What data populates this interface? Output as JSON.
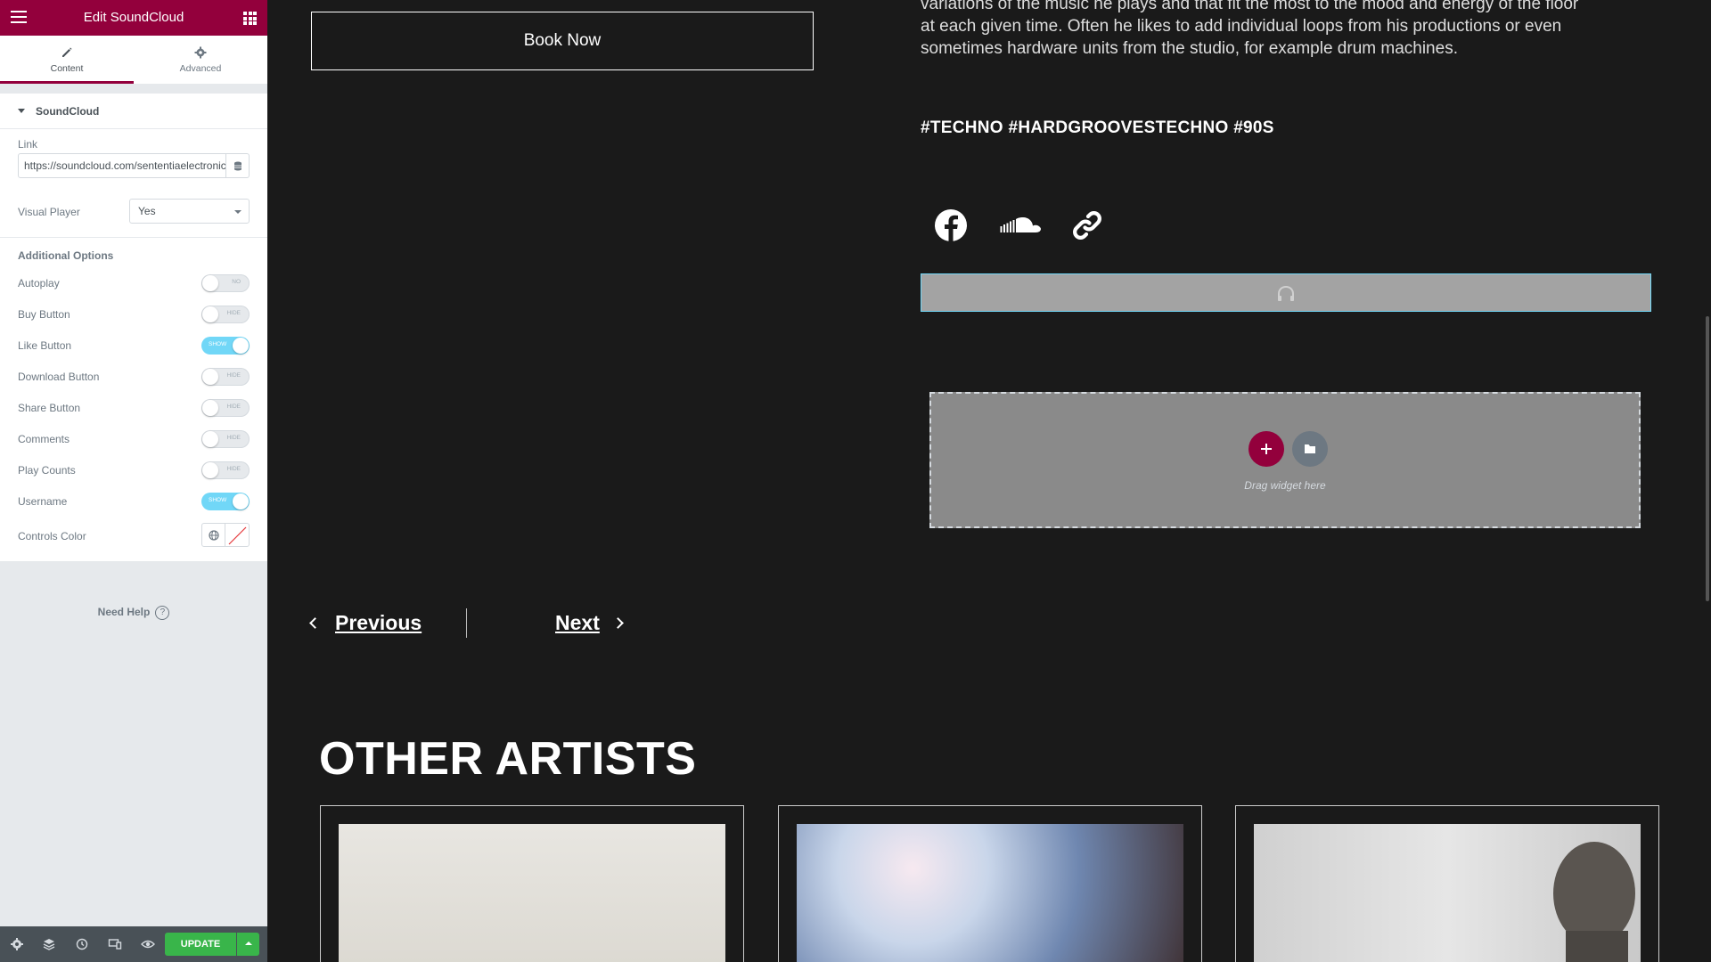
{
  "panel": {
    "title": "Edit SoundCloud",
    "tabs": [
      {
        "label": "Content",
        "icon": "pencil-icon",
        "active": true
      },
      {
        "label": "Advanced",
        "icon": "gear-icon",
        "active": false
      }
    ],
    "section_title": "SoundCloud",
    "link": {
      "label": "Link",
      "value": "https://soundcloud.com/sententiaelectronica"
    },
    "visual_player": {
      "label": "Visual Player",
      "value": "Yes"
    },
    "additional_options": {
      "heading": "Additional Options",
      "toggles": [
        {
          "label": "Autoplay",
          "state": "NO",
          "on": false
        },
        {
          "label": "Buy Button",
          "state": "HIDE",
          "on": false
        },
        {
          "label": "Like Button",
          "state": "SHOW",
          "on": true
        },
        {
          "label": "Download Button",
          "state": "HIDE",
          "on": false
        },
        {
          "label": "Share Button",
          "state": "HIDE",
          "on": false
        },
        {
          "label": "Comments",
          "state": "HIDE",
          "on": false
        },
        {
          "label": "Play Counts",
          "state": "HIDE",
          "on": false
        },
        {
          "label": "Username",
          "state": "SHOW",
          "on": true
        }
      ]
    },
    "controls_color": {
      "label": "Controls Color"
    },
    "need_help": "Need Help",
    "help_glyph": "?",
    "footer": {
      "icons": [
        "settings-icon",
        "layers-icon",
        "history-icon",
        "responsive-icon",
        "eye-icon"
      ],
      "update_label": "UPDATE"
    }
  },
  "page": {
    "book_now": "Book Now",
    "bio_lines": [
      "variations of the music he plays and that fit the most to the mood and energy of the floor",
      "at each given time. Often he likes to add individual loops from his productions or even",
      "sometimes hardware units from the studio, for example drum machines."
    ],
    "tags": "#TECHNO #HARDGROOVESTECHNO #90S",
    "social_icons": [
      "facebook-icon",
      "soundcloud-icon",
      "link-icon"
    ],
    "drag_widget_text": "Drag widget here",
    "prev_label": "Previous",
    "next_label": "Next",
    "other_artists_heading": "OTHER ARTISTS"
  },
  "colors": {
    "brand": "#93003c",
    "update_green": "#39b54a",
    "toggle_on": "#71d7f7",
    "canvas_bg": "#1a1a1a"
  }
}
